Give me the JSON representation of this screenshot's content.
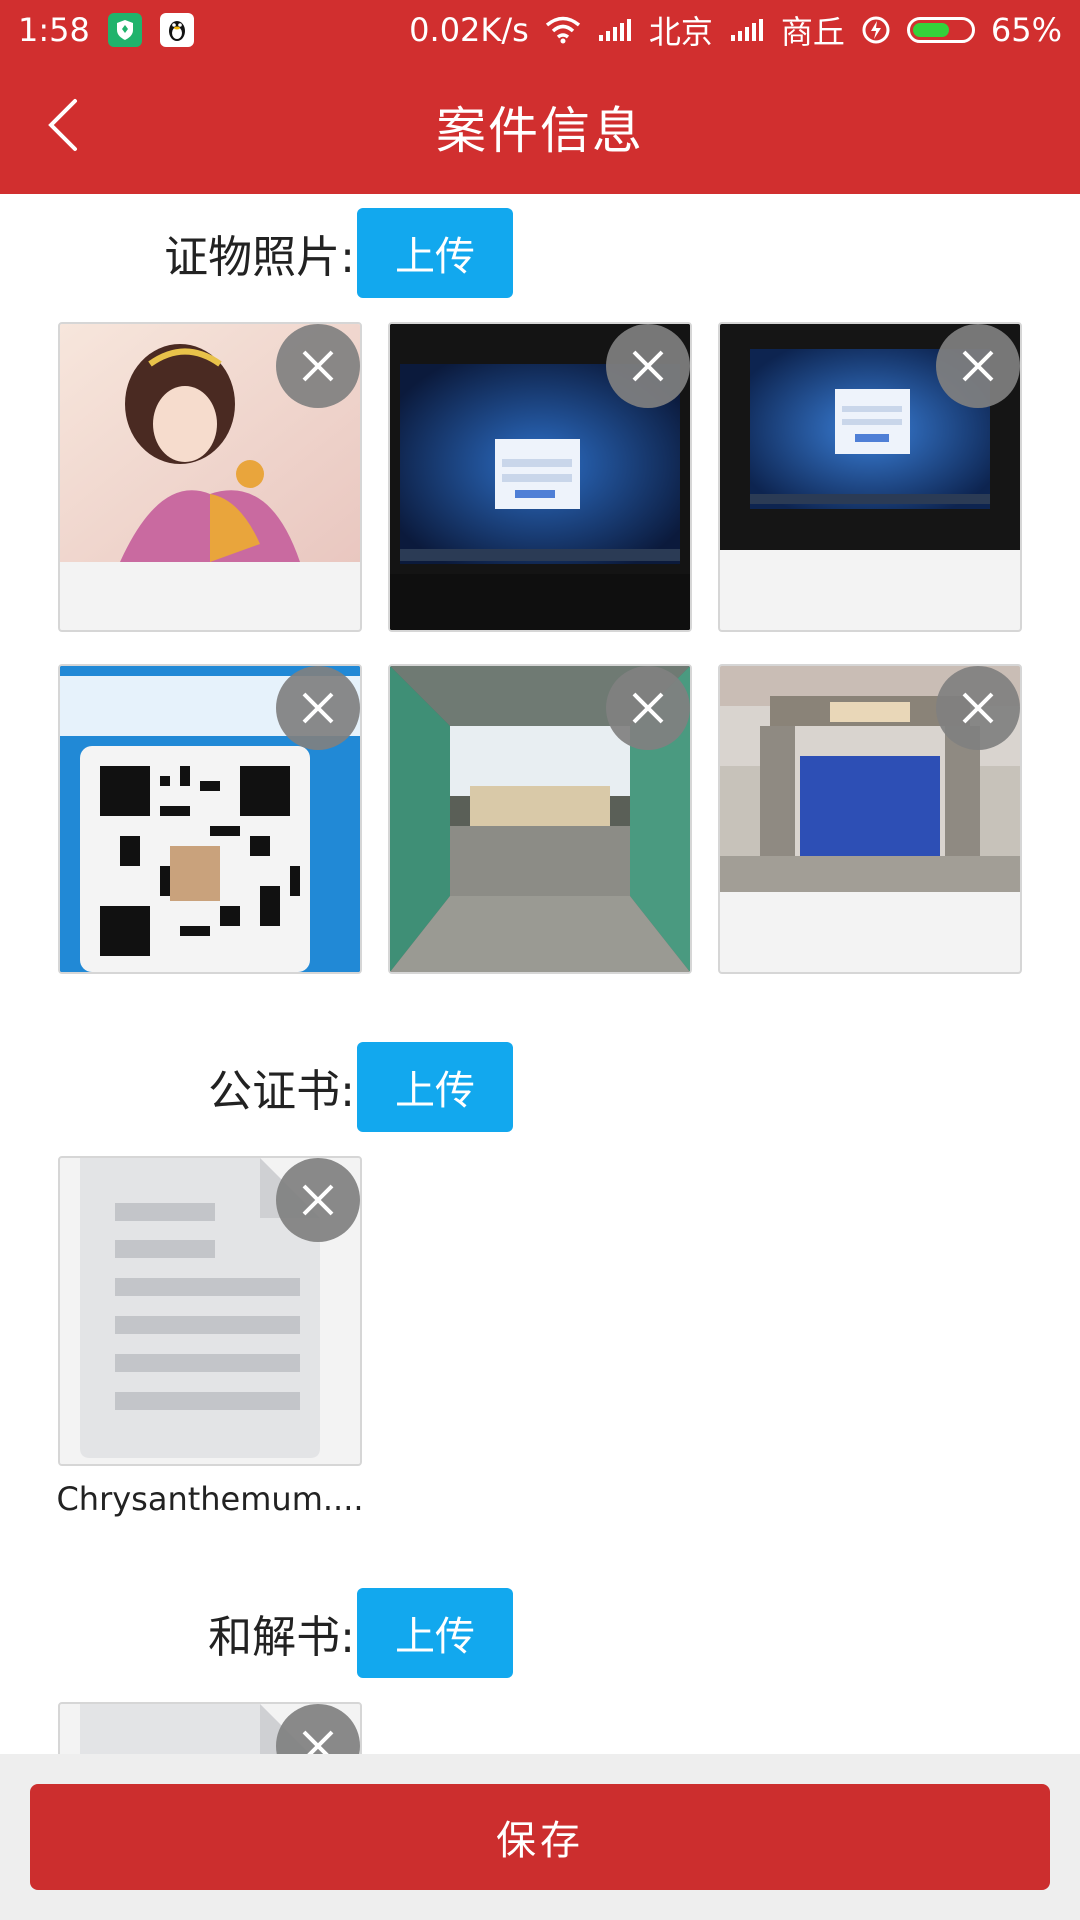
{
  "status_bar": {
    "time": "1:58",
    "speed": "0.02K/s",
    "carrier1": "北京",
    "carrier2": "商丘",
    "battery": "65%",
    "battery_level": 0.65
  },
  "header": {
    "title": "案件信息"
  },
  "sections": {
    "evidence": {
      "label": "证物照片:",
      "upload_label": "上传"
    },
    "notary": {
      "label": "公证书:",
      "upload_label": "上传",
      "file_name": "Chrysanthemum...."
    },
    "settlement": {
      "label": "和解书:",
      "upload_label": "上传"
    }
  },
  "save_label": "保存",
  "colors": {
    "header_red": "#d12f2f",
    "upload_blue": "#12a8ee",
    "delete_gray": "#808080"
  }
}
